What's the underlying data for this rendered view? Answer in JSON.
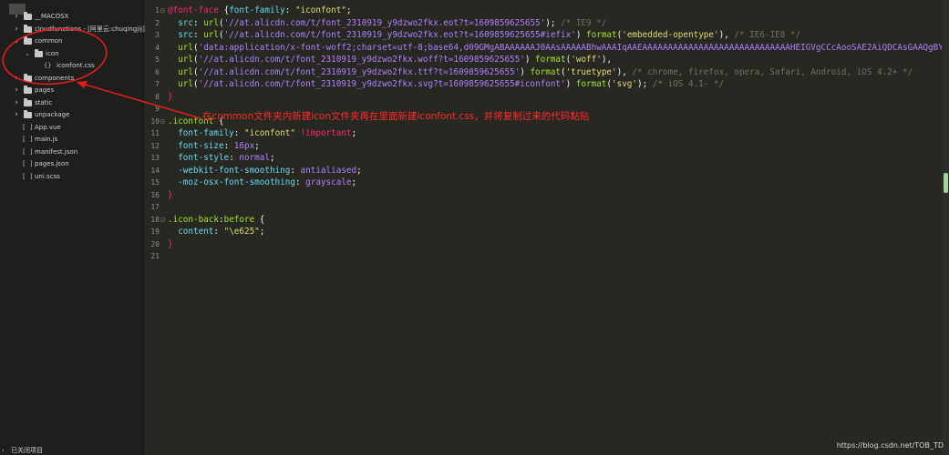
{
  "sidebar": {
    "items": [
      {
        "label": "__MACOSX",
        "kind": "folder",
        "expanded": false,
        "depth": 0
      },
      {
        "label": "cloudfunctions - [阿里云:chuqingjij]",
        "kind": "folder",
        "expanded": false,
        "depth": 0
      },
      {
        "label": "common",
        "kind": "folder",
        "expanded": true,
        "depth": 0
      },
      {
        "label": "icon",
        "kind": "folder",
        "expanded": true,
        "depth": 1
      },
      {
        "label": "iconfont.css",
        "kind": "css-file",
        "expanded": false,
        "depth": 2
      },
      {
        "label": "components",
        "kind": "folder",
        "expanded": false,
        "depth": 0
      },
      {
        "label": "pages",
        "kind": "folder",
        "expanded": false,
        "depth": 0
      },
      {
        "label": "static",
        "kind": "folder",
        "expanded": false,
        "depth": 0
      },
      {
        "label": "unpackage",
        "kind": "folder",
        "expanded": false,
        "depth": 0
      },
      {
        "label": "App.vue",
        "kind": "vue-file",
        "expanded": false,
        "depth": 0
      },
      {
        "label": "main.js",
        "kind": "js-file",
        "expanded": false,
        "depth": 0
      },
      {
        "label": "manifest.json",
        "kind": "json-file",
        "expanded": false,
        "depth": 0
      },
      {
        "label": "pages.json",
        "kind": "json-file",
        "expanded": false,
        "depth": 0
      },
      {
        "label": "uni.scss",
        "kind": "scss-file",
        "expanded": false,
        "depth": 0
      }
    ],
    "footer_label": "已关闭项目"
  },
  "editor": {
    "lines": [
      {
        "n": "1",
        "fold": "⊟",
        "tokens": [
          [
            "kw",
            "@font-face"
          ],
          [
            "plain",
            " {"
          ],
          [
            "prop",
            "font-family"
          ],
          [
            "plain",
            ": "
          ],
          [
            "str",
            "\"iconfont\""
          ],
          [
            "plain",
            ";"
          ]
        ]
      },
      {
        "n": "2",
        "fold": "",
        "tokens": [
          [
            "plain",
            "  "
          ],
          [
            "prop",
            "src"
          ],
          [
            "plain",
            ": "
          ],
          [
            "fn",
            "url"
          ],
          [
            "plain",
            "("
          ],
          [
            "url",
            "'//at.alicdn.com/t/font_2310919_y9dzwo2fkx.eot?t=1609859625655'"
          ],
          [
            "plain",
            "); "
          ],
          [
            "com",
            "/* IE9 */"
          ]
        ]
      },
      {
        "n": "3",
        "fold": "",
        "tokens": [
          [
            "plain",
            "  "
          ],
          [
            "prop",
            "src"
          ],
          [
            "plain",
            ": "
          ],
          [
            "fn",
            "url"
          ],
          [
            "plain",
            "("
          ],
          [
            "url",
            "'//at.alicdn.com/t/font_2310919_y9dzwo2fkx.eot?t=1609859625655#iefix'"
          ],
          [
            "plain",
            ") "
          ],
          [
            "fn",
            "format"
          ],
          [
            "plain",
            "("
          ],
          [
            "str",
            "'embedded-opentype'"
          ],
          [
            "plain",
            "), "
          ],
          [
            "com",
            "/* IE6-IE8 */"
          ]
        ]
      },
      {
        "n": "4",
        "fold": "",
        "tokens": [
          [
            "plain",
            "  "
          ],
          [
            "fn",
            "url"
          ],
          [
            "plain",
            "("
          ],
          [
            "url",
            "'data:application/x-font-woff2;charset=utf-8;base64,d09GMgABAAAAAAJ0AAsAAAAABhwAAAIqAAEAAAAAAAAAAAAAAAAAAAAAAAAAAAAAHEIGVgCCcAooSAE2AiQDCAsGAAQgBYRtBy4"
          ]
        ]
      },
      {
        "n": "5",
        "fold": "",
        "tokens": [
          [
            "plain",
            "  "
          ],
          [
            "fn",
            "url"
          ],
          [
            "plain",
            "("
          ],
          [
            "url",
            "'//at.alicdn.com/t/font_2310919_y9dzwo2fkx.woff?t=1609859625655'"
          ],
          [
            "plain",
            ") "
          ],
          [
            "fn",
            "format"
          ],
          [
            "plain",
            "("
          ],
          [
            "str",
            "'woff'"
          ],
          [
            "plain",
            "),"
          ]
        ]
      },
      {
        "n": "6",
        "fold": "",
        "tokens": [
          [
            "plain",
            "  "
          ],
          [
            "fn",
            "url"
          ],
          [
            "plain",
            "("
          ],
          [
            "url",
            "'//at.alicdn.com/t/font_2310919_y9dzwo2fkx.ttf?t=1609859625655'"
          ],
          [
            "plain",
            ") "
          ],
          [
            "fn",
            "format"
          ],
          [
            "plain",
            "("
          ],
          [
            "str",
            "'truetype'"
          ],
          [
            "plain",
            "), "
          ],
          [
            "com",
            "/* chrome, firefox, opera, Safari, Android, iOS 4.2+ */"
          ]
        ]
      },
      {
        "n": "7",
        "fold": "",
        "tokens": [
          [
            "plain",
            "  "
          ],
          [
            "fn",
            "url"
          ],
          [
            "plain",
            "("
          ],
          [
            "url",
            "'//at.alicdn.com/t/font_2310919_y9dzwo2fkx.svg?t=1609859625655#iconfont'"
          ],
          [
            "plain",
            ") "
          ],
          [
            "fn",
            "format"
          ],
          [
            "plain",
            "("
          ],
          [
            "str",
            "'svg'"
          ],
          [
            "plain",
            "); "
          ],
          [
            "com",
            "/* iOS 4.1- */"
          ]
        ]
      },
      {
        "n": "8",
        "fold": "",
        "tokens": [
          [
            "kw",
            "}"
          ]
        ]
      },
      {
        "n": "9",
        "fold": "",
        "tokens": []
      },
      {
        "n": "10",
        "fold": "⊟",
        "tokens": [
          [
            "sel",
            ".iconfont"
          ],
          [
            "plain",
            " {"
          ]
        ]
      },
      {
        "n": "11",
        "fold": "",
        "tokens": [
          [
            "plain",
            "  "
          ],
          [
            "prop",
            "font-family"
          ],
          [
            "plain",
            ": "
          ],
          [
            "str",
            "\"iconfont\""
          ],
          [
            "plain",
            " "
          ],
          [
            "imp",
            "!important"
          ],
          [
            "plain",
            ";"
          ]
        ]
      },
      {
        "n": "12",
        "fold": "",
        "tokens": [
          [
            "plain",
            "  "
          ],
          [
            "prop",
            "font-size"
          ],
          [
            "plain",
            ": "
          ],
          [
            "val",
            "16px"
          ],
          [
            "plain",
            ";"
          ]
        ]
      },
      {
        "n": "13",
        "fold": "",
        "tokens": [
          [
            "plain",
            "  "
          ],
          [
            "prop",
            "font-style"
          ],
          [
            "plain",
            ": "
          ],
          [
            "val",
            "normal"
          ],
          [
            "plain",
            ";"
          ]
        ]
      },
      {
        "n": "14",
        "fold": "",
        "tokens": [
          [
            "plain",
            "  "
          ],
          [
            "prop",
            "-webkit-font-smoothing"
          ],
          [
            "plain",
            ": "
          ],
          [
            "val",
            "antialiased"
          ],
          [
            "plain",
            ";"
          ]
        ]
      },
      {
        "n": "15",
        "fold": "",
        "tokens": [
          [
            "plain",
            "  "
          ],
          [
            "prop",
            "-moz-osx-font-smoothing"
          ],
          [
            "plain",
            ": "
          ],
          [
            "val",
            "grayscale"
          ],
          [
            "plain",
            ";"
          ]
        ]
      },
      {
        "n": "16",
        "fold": "",
        "tokens": [
          [
            "kw",
            "}"
          ]
        ]
      },
      {
        "n": "17",
        "fold": "",
        "tokens": []
      },
      {
        "n": "18",
        "fold": "⊟",
        "tokens": [
          [
            "sel",
            ".icon-back"
          ],
          [
            "plain",
            ":"
          ],
          [
            "sel",
            "before"
          ],
          [
            "plain",
            " {"
          ]
        ]
      },
      {
        "n": "19",
        "fold": "",
        "tokens": [
          [
            "plain",
            "  "
          ],
          [
            "prop",
            "content"
          ],
          [
            "plain",
            ": "
          ],
          [
            "str",
            "\"\\e625\""
          ],
          [
            "plain",
            ";"
          ]
        ]
      },
      {
        "n": "20",
        "fold": "",
        "tokens": [
          [
            "kw",
            "}"
          ]
        ]
      },
      {
        "n": "21",
        "fold": "",
        "tokens": []
      }
    ]
  },
  "annotation": {
    "text": "在common文件夹内新建icon文件夹再在里面新建iconfont.css，并将复制过来的代码黏贴",
    "color": "#ff2a2a"
  },
  "watermark": "https://blog.csdn.net/TOB_TD",
  "colors": {
    "editor_bg": "#272822",
    "sidebar_bg": "#1e1f1c",
    "keyword": "#f92672",
    "property": "#66d9ef",
    "string": "#e6db74",
    "number": "#ae81ff",
    "comment": "#75715e",
    "function": "#a6e22e"
  }
}
